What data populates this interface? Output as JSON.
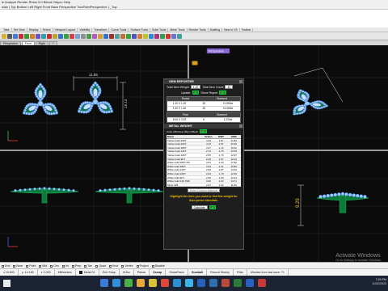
{
  "menu_bar": {
    "text": "le   Analyze   Render   Rhino 5.0   Blend   Clayoo   Help"
  },
  "command_bar": {
    "text": "wise | Top  Bottom  Left  Right  Front  Back  Perspective  TwoPointPerspective ) _Top"
  },
  "toolbar_tabs": [
    "Tabs",
    "Set View",
    "Display",
    "Select",
    "Viewport Layout",
    "Visibility",
    "Transform",
    "Curve Tools",
    "Surface Tools",
    "Solid Tools",
    "Mesh Tools",
    "Render Tools",
    "Drafting",
    "New in V5",
    "Toolbar"
  ],
  "toolbar_icons": [
    "#d9b03a",
    "#5a5a5a",
    "#4a7ad0",
    "#c03030",
    "#3a9a3a",
    "#d08030",
    "#7050c0",
    "#30a0b0",
    "#c03030",
    "#c0a030",
    "#3a70c0",
    "#30a040",
    "#d04040",
    "#7aa0d0",
    "#909090",
    "#4a9a4a",
    "#b05ac0",
    "#d0a030",
    "#3070d0",
    "#a03030",
    "#50a0a0",
    "#c07030",
    "#3aa03a",
    "#5050c0",
    "#d08030",
    "#c0c030",
    "#2a8ad0",
    "#b03080",
    "#30a050",
    "#d03030",
    "#7070d0",
    "#40a0a0"
  ],
  "viewport_tabs": [
    "Perspective",
    "Front",
    "Right"
  ],
  "viewport_tab_add": "+",
  "viewports": {
    "top_left": {
      "dim_horizontal": "11.85",
      "dim_vertical": "19.13"
    },
    "top_right": {
      "title": "Perspective"
    },
    "bottom_right": {
      "dim_vertical": "9.29"
    }
  },
  "gem_reporter": {
    "title": "GEM REPORTER",
    "total_weight_label": "Total Item Weight",
    "total_weight_value": "1.20",
    "total_count_label": "Total Item Count",
    "total_count_value": "42",
    "update_label": "Update",
    "stone_report_label": "Stone Report",
    "round_table": {
      "headers": [
        "Round",
        "Diamond"
      ],
      "rows": [
        [
          "1.20 X 1.20",
          "18",
          "0.1350ct"
        ],
        [
          "1.40 X 1.40",
          "18",
          "0.2160ct"
        ]
      ]
    },
    "pear_table": {
      "headers": [
        "Pear",
        "Diamond"
      ],
      "rows": [
        [
          "5.00 X 3.33",
          "6",
          "1.220ct"
        ]
      ]
    }
  },
  "metal_weight": {
    "title": "METAL WEIGHT",
    "units_label": "Units: MM Area: 86mm*Mesh",
    "headers": [
      "Metal",
      "Grams",
      "DWT",
      "GMS"
    ],
    "rows": [
      [
        "Yellow Gold 24KT",
        "4.46",
        "2.87",
        "21.82"
      ],
      [
        "Yellow Gold 22KT",
        "4.15",
        "2.67",
        "20.36"
      ],
      [
        "Yellow Gold 18KT",
        "3.37",
        "2.16",
        "16.52"
      ],
      [
        "Yellow Gold 14KT",
        "2.72",
        "1.75",
        "13.35"
      ],
      [
        "Yellow Gold 10KT",
        "2.65",
        "1.70",
        "12.97"
      ],
      [
        "Yellow Gold 9KT",
        "2.45",
        "1.57",
        "12.02"
      ],
      [
        "White Gold 18KT PD",
        "3.63",
        "2.33",
        "17.82"
      ],
      [
        "White Gold 18KT",
        "3.43",
        "2.21",
        "16.82"
      ],
      [
        "White Gold 14KT",
        "2.90",
        "1.87",
        "14.22"
      ],
      [
        "White Gold 10KT",
        "2.64",
        "1.70",
        "12.93"
      ],
      [
        "White Gold 9KT",
        "2.50",
        "1.60",
        "12.24"
      ],
      [
        "White Gold 14K PdN",
        "3.00",
        "1.93",
        "14.71"
      ],
      [
        "Silver 925",
        "2.37",
        "1.52",
        "11.60"
      ]
    ],
    "custom_placeholder": "Enter Custom Material",
    "hint": "Highlight the item you want to find the weight for then press calculate.",
    "calculate_label": "Calculate"
  },
  "watermark": {
    "line1": "Activate Windows",
    "line2": "Go to Settings to activate Windows."
  },
  "osnap": [
    "End",
    "Near",
    "Point",
    "Mid",
    "Cen",
    "Int",
    "Perp",
    "Tan",
    "Quad",
    "Knot",
    "Vertex",
    "Project",
    "Disable"
  ],
  "status_bar": {
    "x": "x 15.693",
    "y": "y -14.182",
    "z": "z 0.000",
    "units": "Millimeters",
    "layer": "Metal 01",
    "toggles": [
      "Grid Snap",
      "Ortho",
      "Planar",
      "Osnap",
      "SmartTrack",
      "Gumball",
      "Record History",
      "Filter"
    ],
    "autosave": "Minutes from last save: 71"
  },
  "taskbar": {
    "icons": [
      "#3b7ad8",
      "#2f8fd8",
      "#4ab04a",
      "#e8a93a",
      "#d8c23a",
      "#e0463a",
      "#2d8fd0",
      "#3cb3e8",
      "#2462b8",
      "#2f6fb0",
      "#b84a3a",
      "#2d7a38",
      "#2a60c0",
      "#c83a3a"
    ],
    "time": "7:59 PM",
    "date": "11/02/2023"
  }
}
